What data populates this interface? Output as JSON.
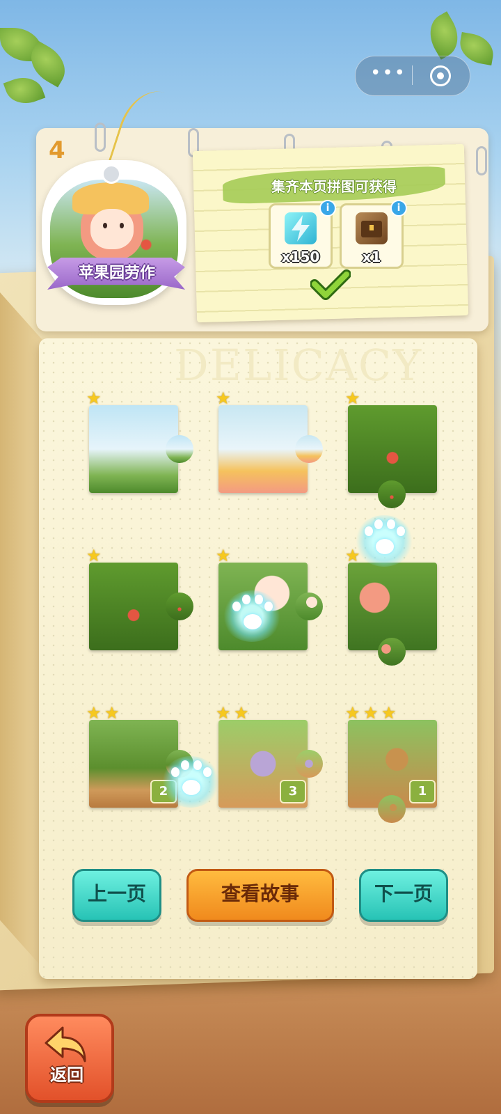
{
  "page_number": "4",
  "character_badge": {
    "name": "苹果园劳作"
  },
  "reward_panel": {
    "title": "集齐本页拼图可获得",
    "items": [
      {
        "icon": "lightning-icon",
        "quantity": "x150",
        "color": "#3fc2d8"
      },
      {
        "icon": "treasure-chest-icon",
        "quantity": "x1",
        "color": "#8a5a2b"
      }
    ],
    "claimed": true,
    "info_label": "i"
  },
  "watermark": "DELICACY",
  "puzzle_pieces": [
    {
      "row": 1,
      "col": 1,
      "stars": 1,
      "count": null,
      "theme": "sky-bushes"
    },
    {
      "row": 1,
      "col": 2,
      "stars": 1,
      "count": null,
      "theme": "hat-girl"
    },
    {
      "row": 1,
      "col": 3,
      "stars": 1,
      "count": null,
      "theme": "apple-tree"
    },
    {
      "row": 2,
      "col": 1,
      "stars": 1,
      "count": null,
      "theme": "apple-tree"
    },
    {
      "row": 2,
      "col": 2,
      "stars": 1,
      "count": null,
      "theme": "girl-face"
    },
    {
      "row": 2,
      "col": 3,
      "stars": 1,
      "count": null,
      "theme": "braid-apples"
    },
    {
      "row": 3,
      "col": 1,
      "stars": 2,
      "count": "2",
      "theme": "orchard-path"
    },
    {
      "row": 3,
      "col": 2,
      "stars": 2,
      "count": "3",
      "theme": "girl-legs"
    },
    {
      "row": 3,
      "col": 3,
      "stars": 3,
      "count": "1",
      "theme": "basket"
    }
  ],
  "buttons": {
    "prev": "上一页",
    "story": "查看故事",
    "next": "下一页",
    "back": "返回"
  },
  "capsule": {
    "more": "•••"
  },
  "colors": {
    "teal_button": "#27c3b5",
    "orange_button": "#f08a1d",
    "back_button": "#e2512a",
    "star": "#f6c81f",
    "count_badge": "#8bb03f",
    "ribbon": "#9a68c9"
  }
}
